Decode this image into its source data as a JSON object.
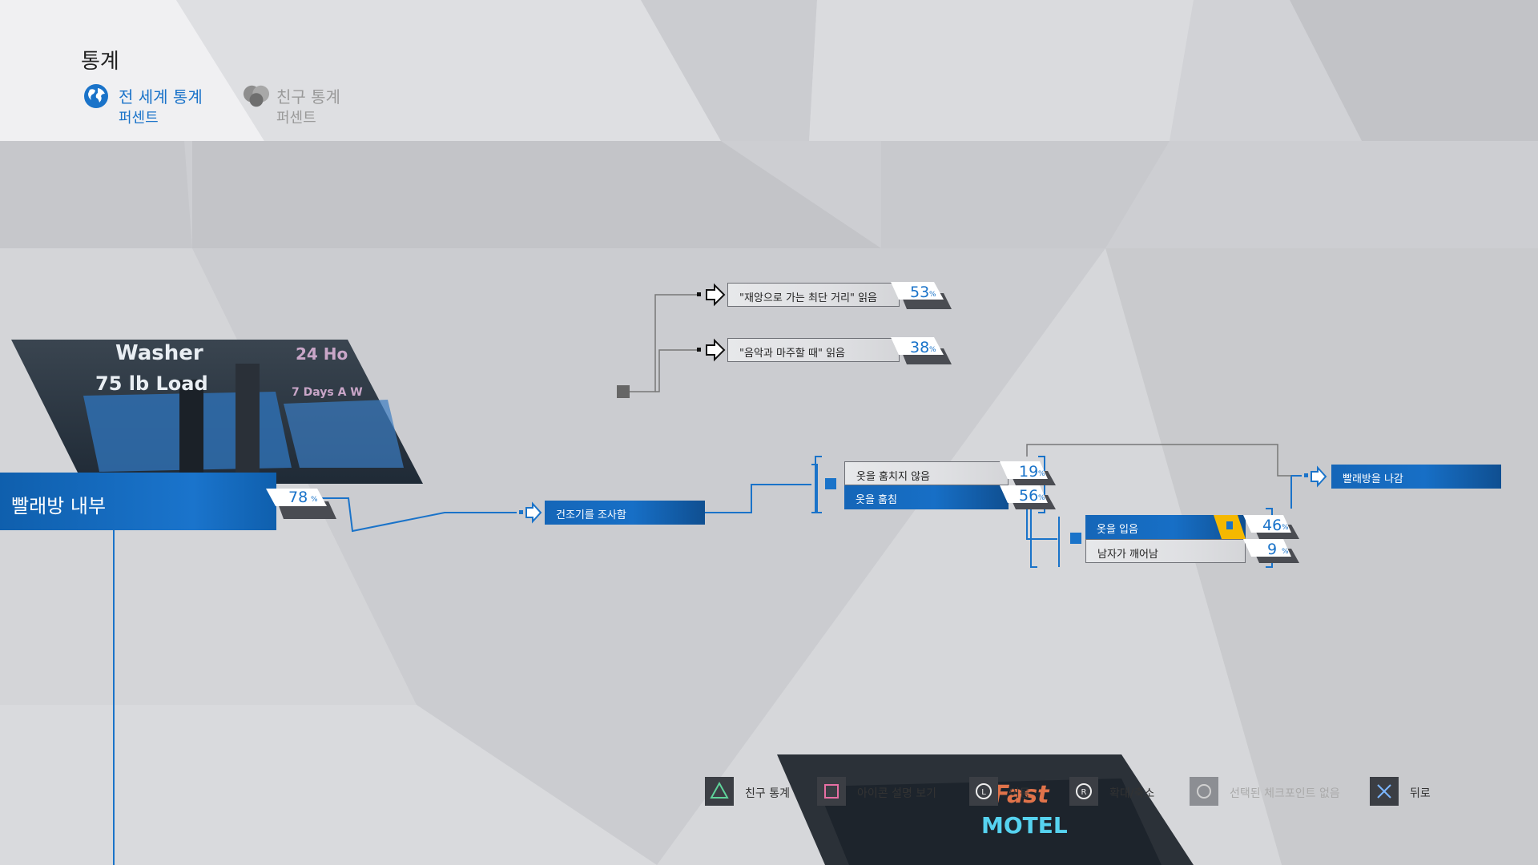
{
  "header": {
    "title": "통계",
    "tabs": [
      {
        "label": "전 세계 통계",
        "sub": "퍼센트",
        "icon": "globe-icon",
        "active": true
      },
      {
        "label": "친구 통계",
        "sub": "퍼센트",
        "icon": "friends-icon",
        "active": false
      }
    ]
  },
  "main_node": {
    "label": "빨래방 내부",
    "percent": "78",
    "unit": "%"
  },
  "thumbnail": {
    "sign_line1": "Washer",
    "sign_line2": "75 lb Load",
    "sign_right1": "24 Ho",
    "sign_right2": "7 Days A W"
  },
  "nodes": {
    "investigate": {
      "label": "건조기를 조사함"
    },
    "read_disaster": {
      "label": "\"재앙으로 가는 최단 거리\" 읽음",
      "percent": "53"
    },
    "read_music": {
      "label": "\"음악과 마주할 때\" 읽음",
      "percent": "38"
    },
    "not_steal": {
      "label": "옷을 훔치지 않음",
      "percent": "19"
    },
    "steal": {
      "label": "옷을 훔침",
      "percent": "56"
    },
    "wear": {
      "label": "옷을 입음",
      "percent": "46"
    },
    "man_wakes": {
      "label": "남자가 깨어남",
      "percent": "9"
    },
    "leave": {
      "label": "빨래방을 나감"
    }
  },
  "percent_unit": "%",
  "buttons": [
    {
      "key": "triangle-button-icon",
      "label": "친구 통계"
    },
    {
      "key": "square-button-icon",
      "label": "아이콘 설명 보기"
    },
    {
      "key": "l-stick-icon",
      "label": "이동"
    },
    {
      "key": "r-stick-icon",
      "label": "확대/축소"
    },
    {
      "key": "circle-button-icon",
      "label": "선택된 체크포인트 없음"
    },
    {
      "key": "cross-button-icon",
      "label": "뒤로"
    }
  ],
  "bottom_thumbnail": {
    "sign_text": "Fast",
    "sign_text2": "MOTEL"
  },
  "colors": {
    "accent": "#1a73c9",
    "highlight": "#f5b800",
    "dark": "#333333"
  }
}
